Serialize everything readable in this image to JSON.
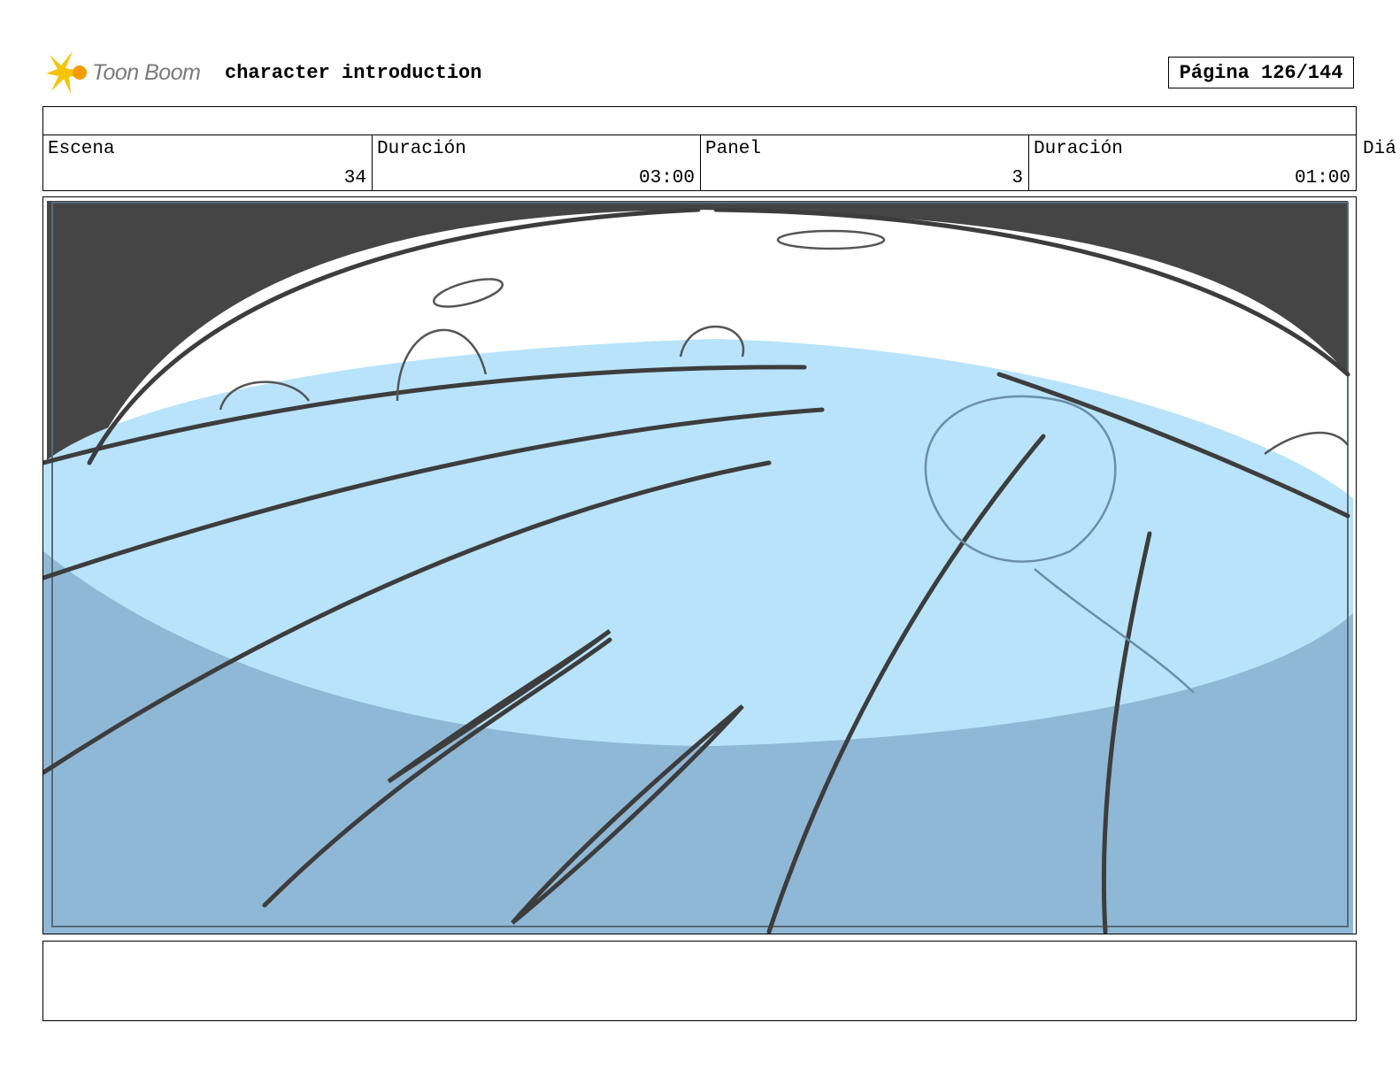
{
  "header": {
    "logo_text": "Toon Boom",
    "project_title": "character introduction",
    "page_label": "Página 126/144"
  },
  "info": {
    "scene_label": "Escena",
    "scene_value": "34",
    "scene_duration_label": "Duración",
    "scene_duration_value": "03:00",
    "panel_label": "Panel",
    "panel_value": "3",
    "panel_duration_label": "Duración",
    "panel_duration_value": "01:00",
    "dialogue_label": "Diá"
  },
  "notes": {
    "text": ""
  },
  "colors": {
    "sketch_blue": "#b8e3fb",
    "sketch_dark": "#464646",
    "shadow_blue": "#8fb8d6"
  }
}
